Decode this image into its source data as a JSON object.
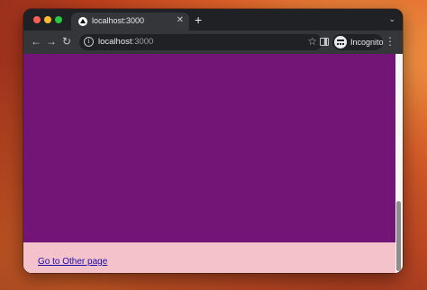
{
  "browser": {
    "tab": {
      "title": "localhost:3000",
      "close_glyph": "✕",
      "favicon": "nextjs-favicon-icon"
    },
    "new_tab_glyph": "+",
    "tab_menu_glyph": "⌄",
    "toolbar": {
      "back_glyph": "←",
      "forward_glyph": "→",
      "reload_glyph": "↻",
      "url_host": "localhost",
      "url_port": ":3000",
      "info_glyph": "i",
      "bookmark_glyph": "☆",
      "profile_label": "Incognito",
      "menu_glyph": "⋮"
    }
  },
  "page": {
    "top_block_color": "#731577",
    "bottom_block_color": "#f4c2cb",
    "link_text": "Go to Other page"
  },
  "scrollbar": {
    "position_fraction": 0.67
  }
}
